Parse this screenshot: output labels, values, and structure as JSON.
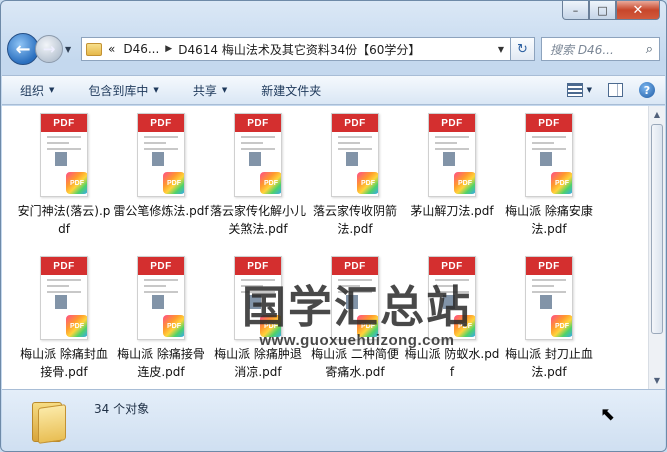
{
  "window": {
    "caption": {
      "minimize": "–",
      "maximize": "□",
      "close": "✕"
    }
  },
  "nav": {
    "back": "←",
    "forward": "→",
    "breadcrumb_prefix": "«",
    "crumbs": [
      "D46...",
      "D4614 梅山法术及其它资料34份【60学分】"
    ],
    "search_placeholder": "搜索 D46...",
    "search_icon": "⌕"
  },
  "toolbar": {
    "organize": "组织",
    "include_in_library": "包含到库中",
    "share": "共享",
    "new_folder": "新建文件夹"
  },
  "files": [
    {
      "name": "安门神法(落云).pdf"
    },
    {
      "name": "雷公笔修炼法.pdf"
    },
    {
      "name": "落云家传化解小儿关煞法.pdf"
    },
    {
      "name": "落云家传收阴箭法.pdf"
    },
    {
      "name": "茅山解刀法.pdf"
    },
    {
      "name": "梅山派 除痛安康法.pdf"
    },
    {
      "name": "梅山派 除痛封血接骨.pdf"
    },
    {
      "name": "梅山派 除痛接骨连皮.pdf"
    },
    {
      "name": "梅山派 除痛肿退消凉.pdf"
    },
    {
      "name": "梅山派 二种简便寄痛水.pdf"
    },
    {
      "name": "梅山派 防蚁水.pdf"
    },
    {
      "name": "梅山派 封刀止血法.pdf"
    }
  ],
  "thumb_label": "PDF",
  "badge_label": "PDF",
  "watermark": {
    "chinese": "国学汇总站",
    "url": "www.guoxuehuizong.com"
  },
  "status": {
    "count": "34 个对象"
  },
  "colors": {
    "pdf_red": "#d42f2f",
    "accent": "#1e395b"
  }
}
